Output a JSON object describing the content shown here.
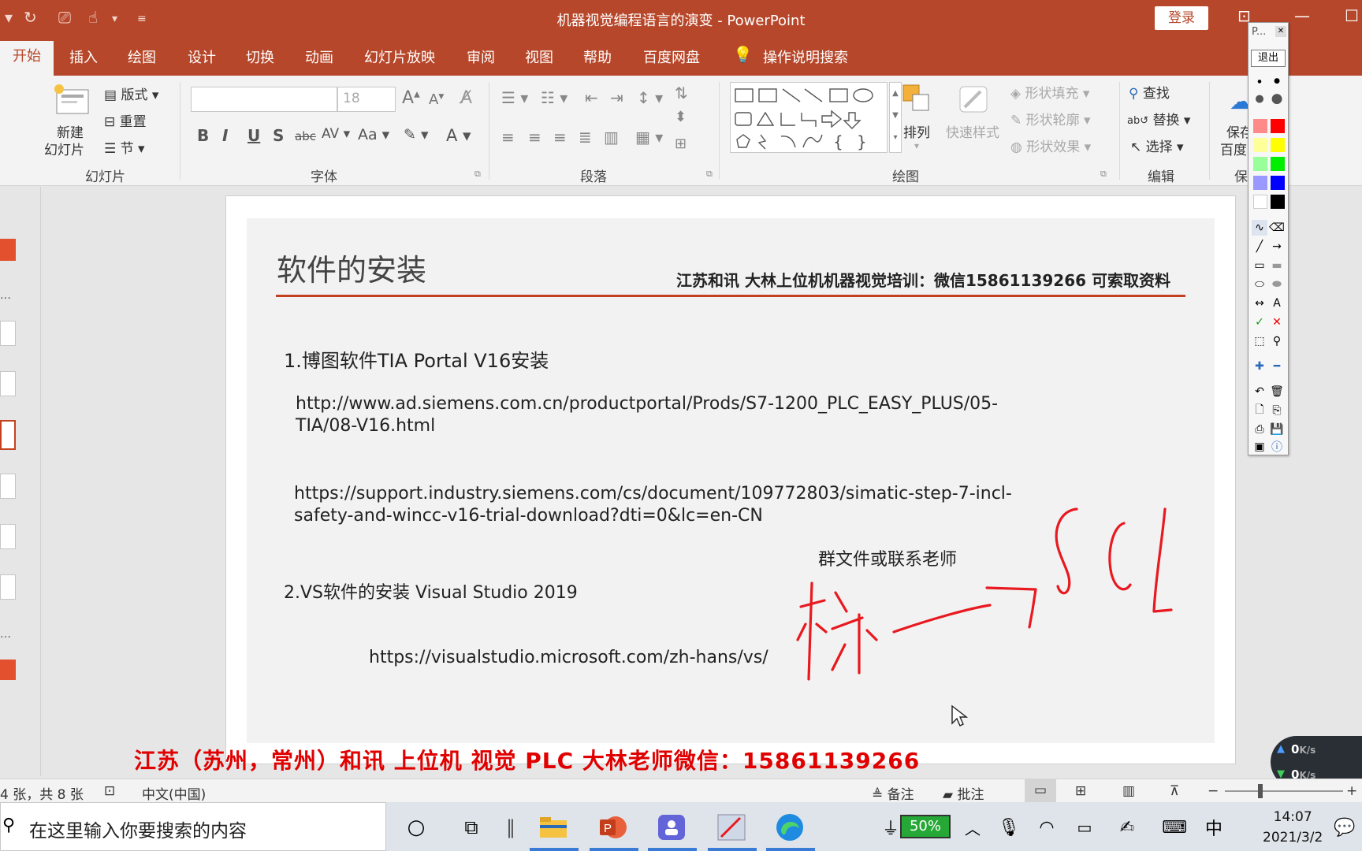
{
  "window": {
    "title": "机器视觉编程语言的演变  -  PowerPoint",
    "login": "登录"
  },
  "tabs": [
    "开始",
    "插入",
    "绘图",
    "设计",
    "切换",
    "动画",
    "幻灯片放映",
    "审阅",
    "视图",
    "帮助",
    "百度网盘",
    "操作说明搜索"
  ],
  "ribbon": {
    "slides": {
      "new_slide": "新建",
      "new_slide2": "幻灯片",
      "layout": "版式",
      "reset": "重置",
      "section": "节",
      "label": "幻灯片"
    },
    "font": {
      "font_name": "",
      "font_size": "18",
      "label": "字体"
    },
    "paragraph": {
      "label": "段落"
    },
    "drawing": {
      "arrange": "排列",
      "quick_styles": "快速样式",
      "shape_fill": "形状填充",
      "shape_outline": "形状轮廓",
      "shape_effects": "形状效果",
      "label": "绘图"
    },
    "editing": {
      "find": "查找",
      "replace": "替换",
      "select": "选择",
      "label": "编辑"
    },
    "extra": {
      "save1": "保存",
      "save2": "百度",
      "label": "保"
    }
  },
  "slide": {
    "title": "软件的安装",
    "header": "江苏和讯   大林上位机机器视觉培训：微信15861139266 可索取资料",
    "item1": "1.博图软件TIA Portal V16安装",
    "url1_l1": "http://www.ad.siemens.com.cn/productportal/Prods/S7-1200_PLC_EASY_PLUS/05-",
    "url1_l2": "TIA/08-V16.html",
    "url2_l1": "https://support.industry.siemens.com/cs/document/109772803/simatic-step-7-incl-",
    "url2_l2": "safety-and-wincc-v16-trial-download?dti=0&lc=en-CN",
    "note": "群文件或联系老师",
    "item2": "2.VS软件的安装 Visual Studio 2019",
    "url3": "https://visualstudio.microsoft.com/zh-hans/vs/"
  },
  "banner": "江苏（苏州，常州）和讯 上位机  视觉  PLC 大林老师微信：15861139266",
  "network": {
    "up": "0",
    "down": "0",
    "unit": "K/s"
  },
  "status": {
    "slide_count": "4 张，共 8 张",
    "language": "中文(中国)",
    "notes": "备注",
    "comments": "批注"
  },
  "taskbar": {
    "search_placeholder": "在这里输入你要搜索的内容",
    "battery": "50%",
    "ime": "中",
    "time": "14:07",
    "date": "2021/3/2"
  },
  "pen_toolbar": {
    "title": "P...",
    "exit": "退出"
  },
  "colors": {
    "accent": "#b7472a",
    "rule": "#c3411f",
    "banner": "#e00000",
    "ink": "#e8191f"
  }
}
